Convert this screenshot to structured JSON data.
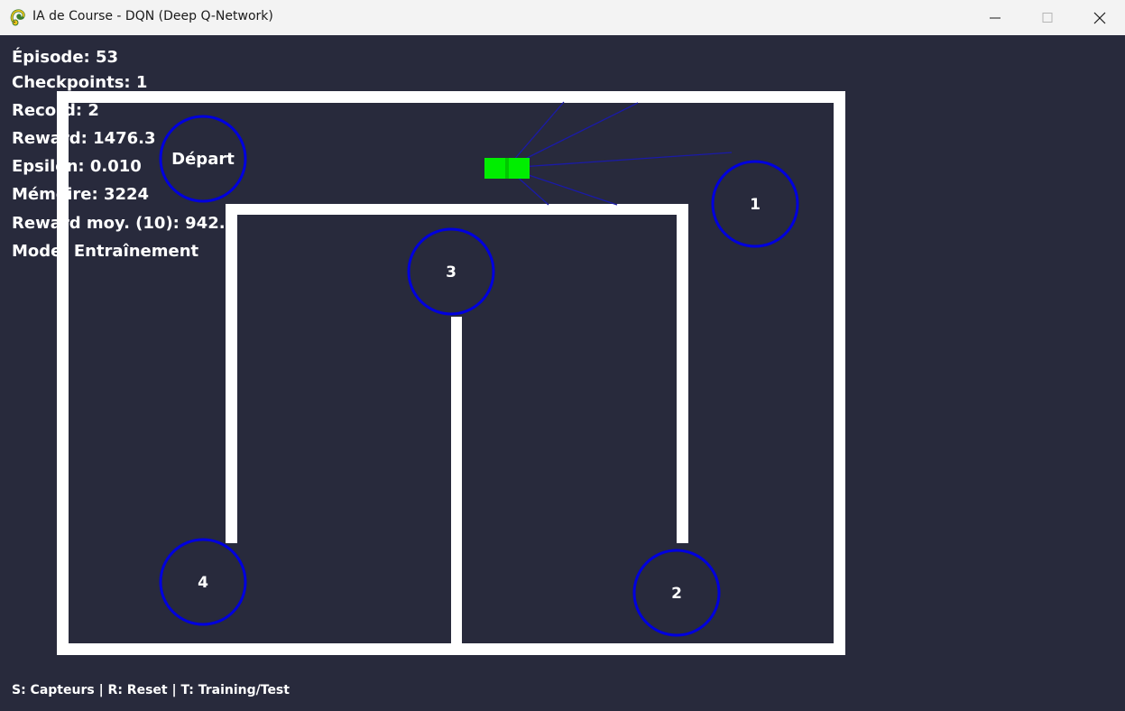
{
  "window": {
    "title": "IA de Course - DQN (Deep Q-Network)",
    "icon": "pygame-snake-icon"
  },
  "hud": {
    "episode": "Épisode: 53",
    "checkpoints": "Checkpoints: 1",
    "record": "Record: 2",
    "reward": "Reward: 1476.3",
    "epsilon": "Epsilon: 0.010",
    "memory": "Mémoire: 3224",
    "reward_avg": "Reward moy. (10): 942.6",
    "mode": "Mode: Entraînement"
  },
  "checkpoints": {
    "start": "Départ",
    "cp1": "1",
    "cp2": "2",
    "cp3": "3",
    "cp4": "4"
  },
  "help": "S: Capteurs | R: Reset | T: Training/Test",
  "colors": {
    "background": "#282a3c",
    "walls": "#ffffff",
    "checkpoint_ring": "#0000dd",
    "car": "#00ee00",
    "sensors": "#1a1aa8"
  }
}
